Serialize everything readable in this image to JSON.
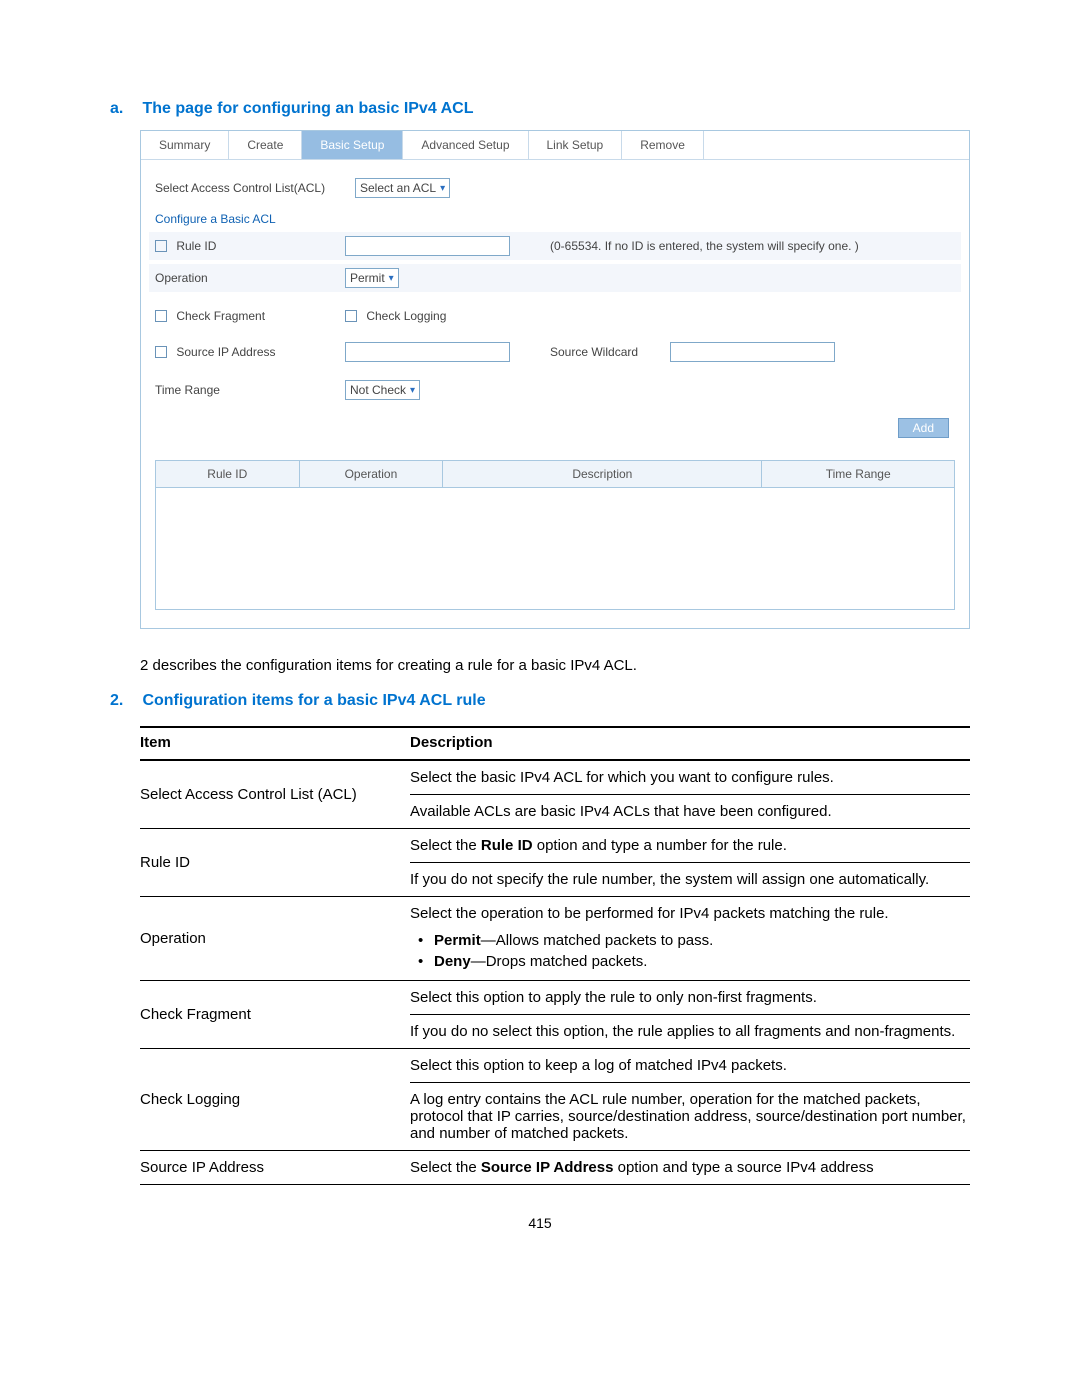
{
  "heading_a": {
    "num": "a.",
    "text": "The page for configuring an basic IPv4 ACL"
  },
  "tabs": [
    "Summary",
    "Create",
    "Basic Setup",
    "Advanced Setup",
    "Link Setup",
    "Remove"
  ],
  "active_tab_index": 2,
  "form": {
    "select_acl_label": "Select Access Control List(ACL)",
    "select_acl_value": "Select an ACL",
    "configure_title": "Configure a Basic ACL",
    "rule_id_label": "Rule ID",
    "rule_id_hint": "(0-65534. If no ID is entered, the system will specify one. )",
    "operation_label": "Operation",
    "operation_value": "Permit",
    "check_fragment": "Check Fragment",
    "check_logging": "Check Logging",
    "source_ip_label": "Source IP Address",
    "source_wildcard_label": "Source Wildcard",
    "time_range_label": "Time Range",
    "time_range_value": "Not Check",
    "add_button": "Add"
  },
  "grid_headers": {
    "rule_id": "Rule ID",
    "operation": "Operation",
    "description": "Description",
    "time_range": "Time Range"
  },
  "para_2": "2 describes the configuration items for creating a rule for a basic IPv4 ACL.",
  "heading_2": {
    "num": "2.",
    "text": "Configuration items for a basic IPv4 ACL rule"
  },
  "table": {
    "head_item": "Item",
    "head_desc": "Description",
    "rows": [
      {
        "item": "Select Access Control List (ACL)",
        "desc": [
          "Select the basic IPv4 ACL for which you want to configure rules.",
          "Available ACLs are basic IPv4 ACLs that have been configured."
        ]
      },
      {
        "item": "Rule ID",
        "desc_html": "rule_id"
      },
      {
        "item": "Operation",
        "desc_html": "operation"
      },
      {
        "item": "Check Fragment",
        "desc": [
          "Select this option to apply the rule to only non-first fragments.",
          "If you do no select this option, the rule applies to all fragments and non-fragments."
        ]
      },
      {
        "item": "Check Logging",
        "desc": [
          "Select this option to keep a log of matched IPv4 packets.",
          "A log entry contains the ACL rule number, operation for the matched packets, protocol that IP carries, source/destination address, source/destination port number, and number of matched packets."
        ]
      },
      {
        "item": "Source IP Address",
        "desc_html": "source_ip"
      }
    ],
    "rule_id_p1_a": "Select the ",
    "rule_id_p1_b": "Rule ID",
    "rule_id_p1_c": " option and type a number for the rule.",
    "rule_id_p2": "If you do not specify the rule number, the system will assign one automatically.",
    "op_p1": "Select the operation to be performed for IPv4 packets matching the rule.",
    "op_b1_a": "Permit",
    "op_b1_b": "—Allows matched packets to pass.",
    "op_b2_a": "Deny",
    "op_b2_b": "—Drops matched packets.",
    "src_a": "Select the ",
    "src_b": "Source IP Address",
    "src_c": " option and type a source IPv4 address"
  },
  "page_number": "415"
}
